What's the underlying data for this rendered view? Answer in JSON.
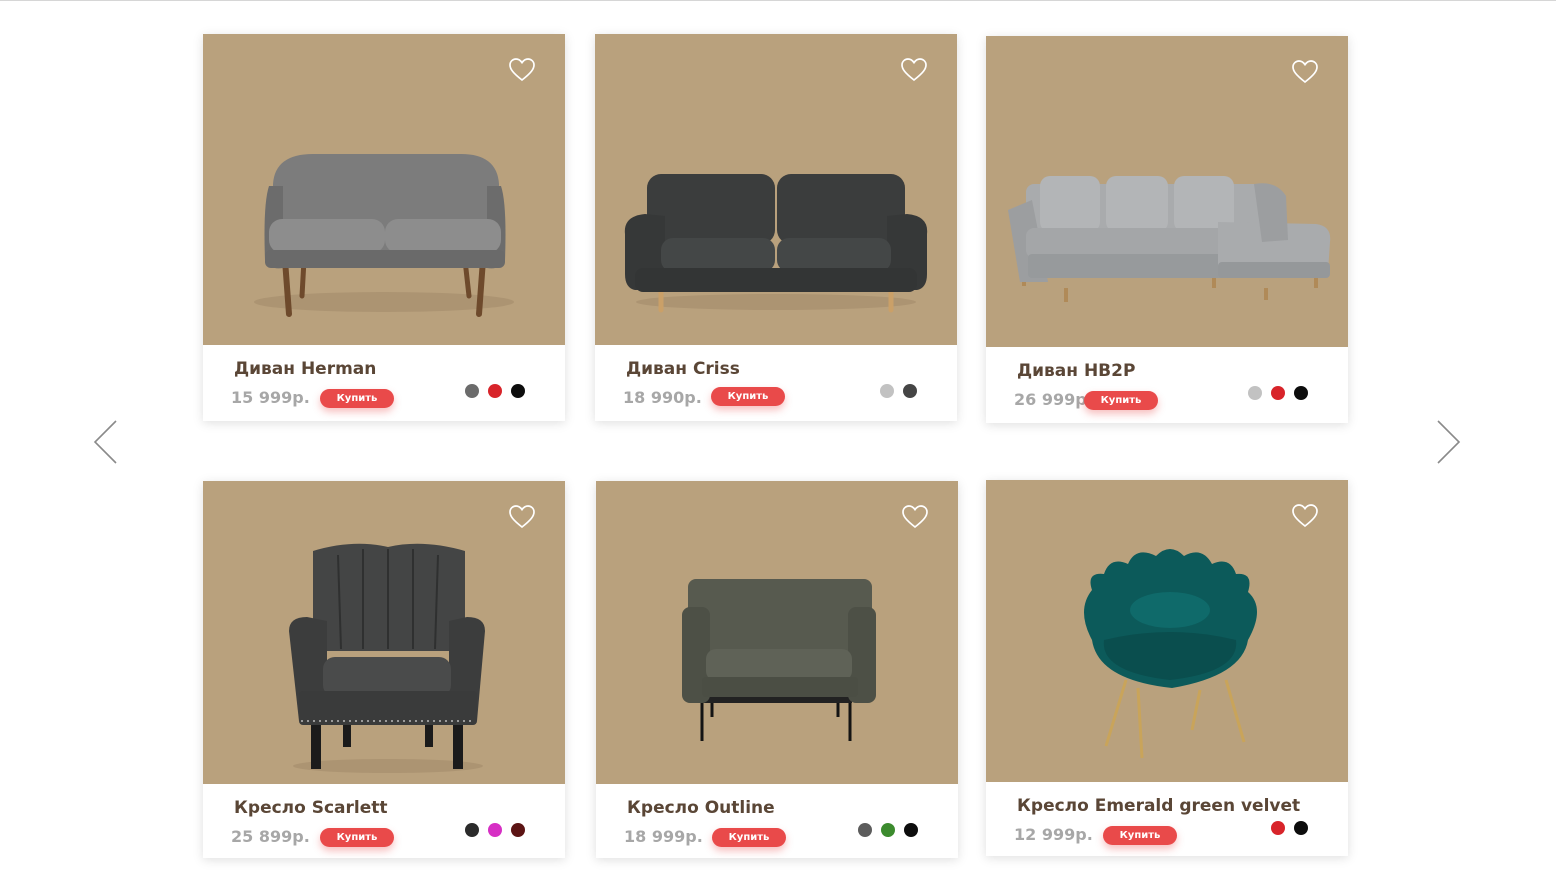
{
  "buy_label": "Купить",
  "products": [
    {
      "name": "Диван Herman",
      "price": "15 999р.",
      "colors": [
        "#6b6b6b",
        "#d8242a",
        "#0d0d0d"
      ]
    },
    {
      "name": "Диван Criss",
      "price": "18 990р.",
      "colors": [
        "#c2c2c2",
        "#454545"
      ]
    },
    {
      "name": "Диван HB2P",
      "price": "26 999р.",
      "colors": [
        "#c2c2c2",
        "#d8242a",
        "#0d0d0d"
      ]
    },
    {
      "name": "Кресло Scarlett",
      "price": "25 899р.",
      "colors": [
        "#2b2b2b",
        "#d62fc4",
        "#5c1414"
      ]
    },
    {
      "name": "Кресло Outline",
      "price": "18 999р.",
      "colors": [
        "#5c5c5c",
        "#3c8b2e",
        "#0d0d0d"
      ]
    },
    {
      "name": "Кресло Emerald green velvet",
      "price": "12 999р.",
      "colors": [
        "#d8242a",
        "#0d0d0d"
      ]
    }
  ],
  "icons": {
    "heart": "heart-outline-icon",
    "prev": "chevron-left-icon",
    "next": "chevron-right-icon"
  },
  "colors": {
    "card_bg": "#b9a17d",
    "buy_button": "#e94a4a",
    "title_text": "#5a4636",
    "price_text": "#a7a7a7"
  }
}
